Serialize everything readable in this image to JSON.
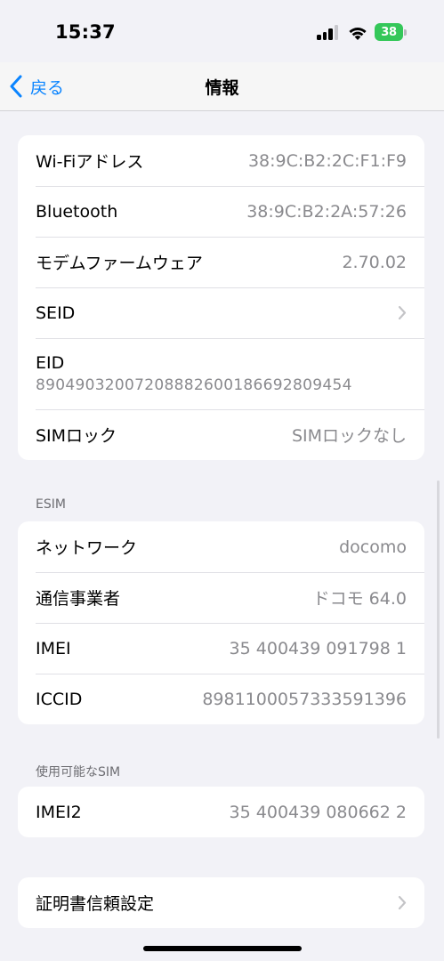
{
  "status_bar": {
    "time": "15:37",
    "battery": "38"
  },
  "nav": {
    "back_label": "戻る",
    "title": "情報"
  },
  "group1": {
    "rows": [
      {
        "label": "Wi-Fiアドレス",
        "value": "38:9C:B2:2C:F1:F9"
      },
      {
        "label": "Bluetooth",
        "value": "38:9C:B2:2A:57:26"
      },
      {
        "label": "モデムファームウェア",
        "value": "2.70.02"
      },
      {
        "label": "SEID"
      },
      {
        "label": "EID",
        "value": "89049032007208882600186692809454"
      },
      {
        "label": "SIMロック",
        "value": "SIMロックなし"
      }
    ]
  },
  "esim": {
    "header": "ESIM",
    "rows": [
      {
        "label": "ネットワーク",
        "value": "docomo"
      },
      {
        "label": "通信事業者",
        "value": "ドコモ 64.0"
      },
      {
        "label": "IMEI",
        "value": "35 400439 091798 1"
      },
      {
        "label": "ICCID",
        "value": "8981100057333591396"
      }
    ]
  },
  "available_sim": {
    "header": "使用可能なSIM",
    "rows": [
      {
        "label": "IMEI2",
        "value": "35 400439 080662 2"
      }
    ]
  },
  "cert": {
    "label": "証明書信頼設定"
  }
}
